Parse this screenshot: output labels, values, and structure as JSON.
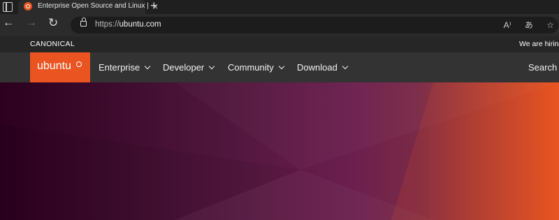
{
  "browser": {
    "tab": {
      "title": "Enterprise Open Source and Linux | Ubuntu"
    },
    "address": {
      "scheme": "https://",
      "host": "ubuntu.com"
    },
    "icons": [
      "tab-actions-icon",
      "ubuntu-favicon-icon",
      "close-icon",
      "new-tab-icon",
      "back-icon",
      "forward-icon",
      "reload-icon",
      "lock-icon",
      "read-aloud-icon",
      "translate-icon",
      "favorites-star-icon"
    ]
  },
  "canonical_bar": {
    "brand": "CANONICAL",
    "hiring": "We are hiring"
  },
  "nav": {
    "logo": "ubuntu",
    "items": [
      {
        "label": "Enterprise"
      },
      {
        "label": "Developer"
      },
      {
        "label": "Community"
      },
      {
        "label": "Download"
      }
    ],
    "search": "Search"
  },
  "colors": {
    "brand": "#e95420",
    "aubergine": "#2c001e",
    "navbar": "#333333"
  }
}
